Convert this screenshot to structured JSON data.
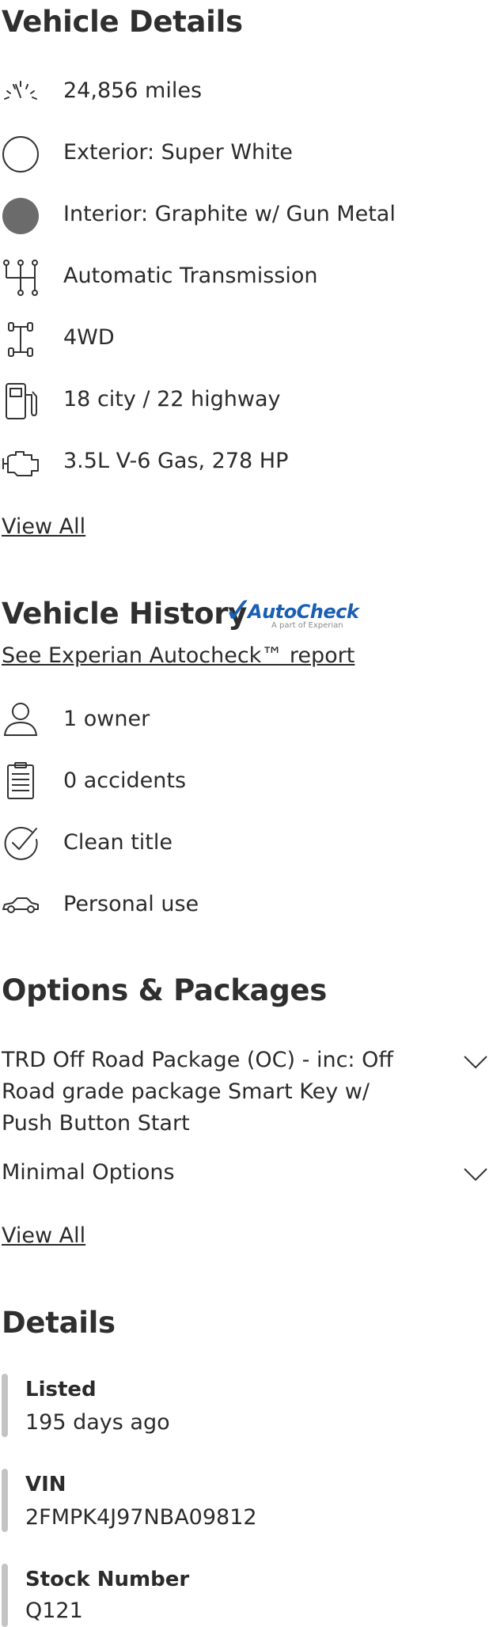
{
  "vehicle_details": {
    "title": "Vehicle Details",
    "items": [
      {
        "icon": "speedometer-icon",
        "text": "24,856 miles"
      },
      {
        "icon": "exterior-color-swatch-icon",
        "text": "Exterior: Super White",
        "swatch_color": "#ffffff"
      },
      {
        "icon": "interior-color-swatch-icon",
        "text": "Interior: Graphite w/ Gun Metal",
        "swatch_color": "#6b6b6b"
      },
      {
        "icon": "transmission-icon",
        "text": "Automatic Transmission"
      },
      {
        "icon": "drivetrain-icon",
        "text": "4WD"
      },
      {
        "icon": "fuel-pump-icon",
        "text": "18 city / 22 highway"
      },
      {
        "icon": "engine-icon",
        "text": "3.5L V-6 Gas, 278 HP"
      }
    ],
    "view_all_label": "View All"
  },
  "vehicle_history": {
    "title": "Vehicle History",
    "logo": {
      "check": "✓",
      "name": "AutoCheck",
      "sub": "A part of Experian",
      "color": "#1a5fb4"
    },
    "report_link": "See Experian Autocheck™ report",
    "items": [
      {
        "icon": "owner-icon",
        "text": "1 owner"
      },
      {
        "icon": "clipboard-icon",
        "text": "0 accidents"
      },
      {
        "icon": "check-circle-icon",
        "text": "Clean title"
      },
      {
        "icon": "car-icon",
        "text": "Personal use"
      }
    ]
  },
  "options_packages": {
    "title": "Options & Packages",
    "items": [
      {
        "text": "TRD Off Road Package (OC) - inc: Off Road grade package Smart Key w/ Push Button Start"
      },
      {
        "text": "Minimal Options"
      }
    ],
    "view_all_label": "View All"
  },
  "details": {
    "title": "Details",
    "items": [
      {
        "label": "Listed",
        "value": "195 days ago"
      },
      {
        "label": "VIN",
        "value": "2FMPK4J97NBA09812"
      },
      {
        "label": "Stock Number",
        "value": "Q121"
      }
    ]
  }
}
